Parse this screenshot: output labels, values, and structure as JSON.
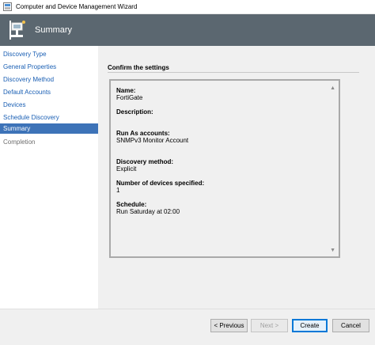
{
  "window": {
    "title": "Computer and Device Management Wizard"
  },
  "banner": {
    "title": "Summary"
  },
  "nav": {
    "items": [
      {
        "label": "Discovery Type",
        "state": "link"
      },
      {
        "label": "General Properties",
        "state": "link"
      },
      {
        "label": "Discovery Method",
        "state": "link"
      },
      {
        "label": "Default Accounts",
        "state": "link"
      },
      {
        "label": "Devices",
        "state": "link"
      },
      {
        "label": "Schedule Discovery",
        "state": "link"
      },
      {
        "label": "Summary",
        "state": "selected"
      },
      {
        "label": "Completion",
        "state": "disabled"
      }
    ]
  },
  "main": {
    "section_label": "Confirm the settings",
    "summary": {
      "name_label": "Name:",
      "name_value": "FortiGate",
      "description_label": "Description:",
      "description_value": "",
      "runas_label": "Run As accounts:",
      "runas_value": "SNMPv3 Monitor Account",
      "method_label": "Discovery method:",
      "method_value": "Explicit",
      "devices_label": "Number of devices specified:",
      "devices_value": "1",
      "schedule_label": "Schedule:",
      "schedule_value": "Run Saturday at 02:00"
    }
  },
  "footer": {
    "previous_label": "< Previous",
    "next_label": "Next >",
    "create_label": "Create",
    "cancel_label": "Cancel"
  },
  "colors": {
    "banner": "#5b6770",
    "nav_link": "#1a5fb4",
    "nav_selected": "#3d73b8",
    "content_bg": "#f0f0f0"
  },
  "icons": {
    "app": "wizard-app-icon",
    "banner": "discovery-wizard-icon",
    "scroll_up": "scroll-up-arrow-icon",
    "scroll_down": "scroll-down-arrow-icon"
  }
}
